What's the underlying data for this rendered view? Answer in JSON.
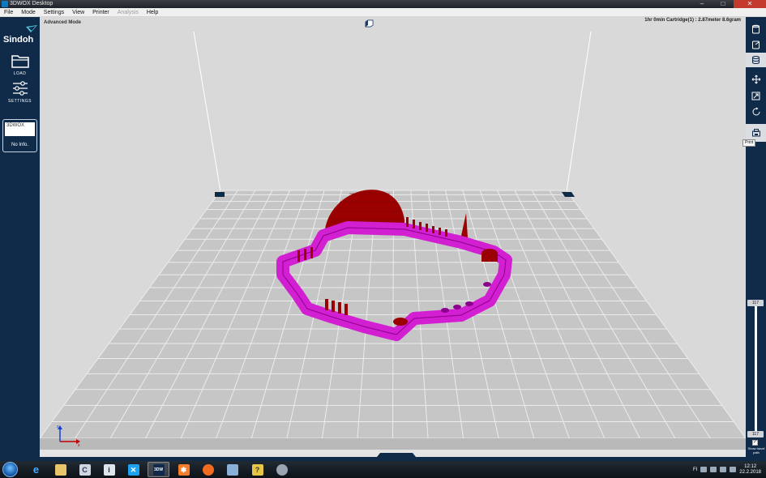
{
  "window": {
    "title": "3DWOX Desktop",
    "minimize": "–",
    "maximize": "□",
    "close": "✕"
  },
  "menu": [
    {
      "label": "File",
      "enabled": true
    },
    {
      "label": "Mode",
      "enabled": true
    },
    {
      "label": "Settings",
      "enabled": true
    },
    {
      "label": "View",
      "enabled": true
    },
    {
      "label": "Printer",
      "enabled": true
    },
    {
      "label": "Analysis",
      "enabled": false
    },
    {
      "label": "Help",
      "enabled": true
    }
  ],
  "sidebar": {
    "logo_text": "Sindoh",
    "load_label": "LOAD",
    "settings_label": "SETTINGS",
    "printer_card": {
      "name": "3DWOX",
      "info": "No Info."
    }
  },
  "viewport": {
    "mode_label": "Advanced Mode",
    "print_info": "1hr 0min  Cartridge(1) : 2.87meter 8.6gram",
    "view_buttons": [
      "view-3d-icon",
      "view-front-icon",
      "view-left-icon",
      "view-top-icon",
      "view-right-icon"
    ]
  },
  "right_toolbar": {
    "buttons": [
      "cartridge-icon",
      "material-icon",
      "layers-icon",
      "move-icon",
      "scale-icon",
      "rotate-icon",
      "print-icon"
    ],
    "active": "layers-icon",
    "print_tooltip": "Print",
    "layer_top": "117",
    "layer_bottom": "117",
    "travel_label": "Show travel path",
    "travel_checked": true
  },
  "taskbar": {
    "apps": [
      "ie-icon",
      "explorer-icon",
      "ccleaner-icon",
      "info-icon",
      "twitter-icon",
      "3dwox-icon",
      "xampp-icon",
      "firefox-icon",
      "files-icon",
      "help-icon",
      "tool-icon"
    ],
    "active_app": "3dwox-icon",
    "language": "FI",
    "time": "12:12",
    "date": "22.2.2018"
  },
  "colors": {
    "sidebar": "#102b4a",
    "viewport_bg": "#d9d9d9",
    "bed": "#c8c8c8",
    "model_magenta": "#d21fd2",
    "model_red": "#9a0000"
  }
}
